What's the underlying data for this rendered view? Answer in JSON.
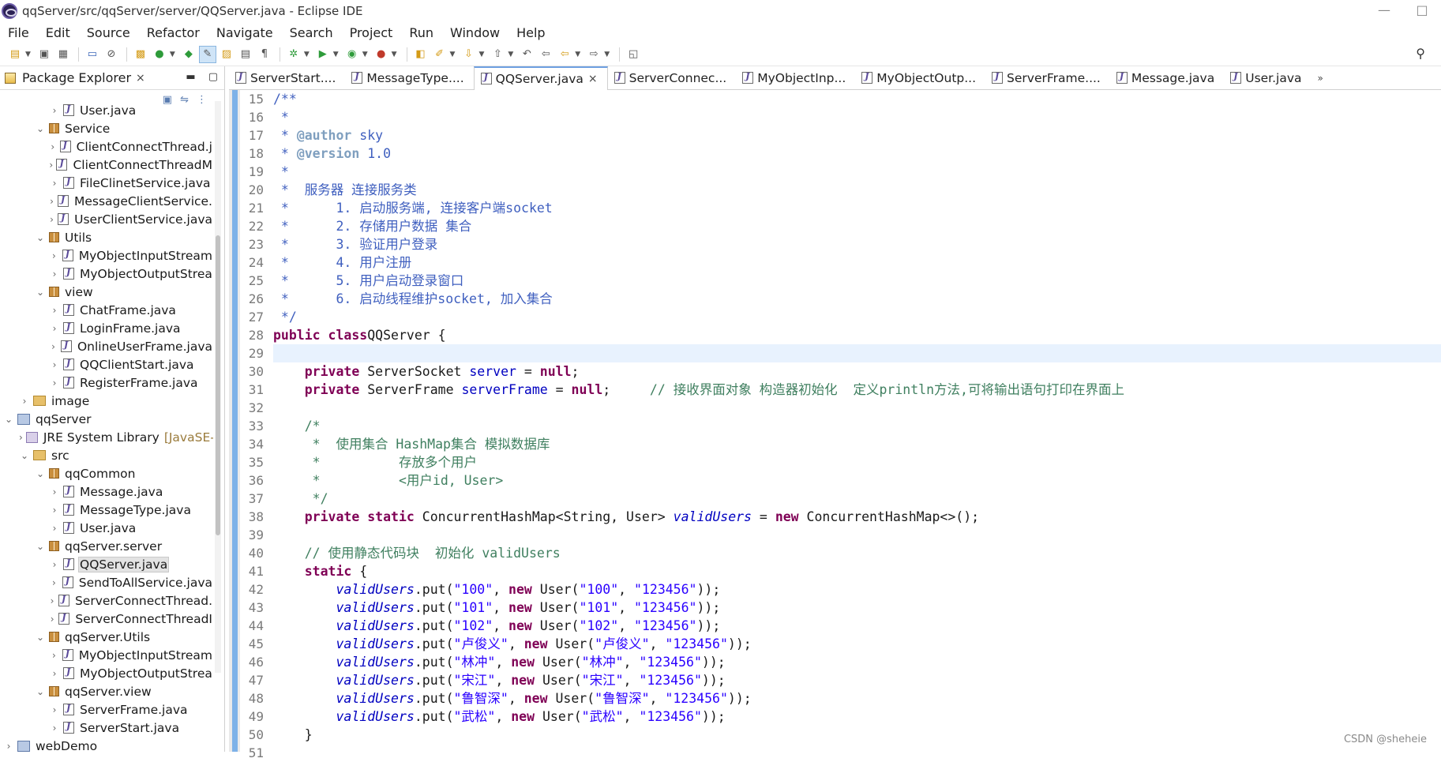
{
  "window": {
    "title": "qqServer/src/qqServer/server/QQServer.java - Eclipse IDE",
    "minimize": "—",
    "maximize": "□"
  },
  "menu": [
    "File",
    "Edit",
    "Source",
    "Refactor",
    "Navigate",
    "Search",
    "Project",
    "Run",
    "Window",
    "Help"
  ],
  "explorer": {
    "title": "Package Explorer",
    "close": "×",
    "minimize": "▬",
    "maximize": "▢",
    "tree": [
      {
        "label": "User.java",
        "type": "java",
        "depth": 3,
        "arrow": "›"
      },
      {
        "label": "Service",
        "type": "pkg",
        "depth": 2,
        "arrow": "⌄"
      },
      {
        "label": "ClientConnectThread.j",
        "type": "java",
        "depth": 3,
        "arrow": "›"
      },
      {
        "label": "ClientConnectThreadM",
        "type": "java",
        "depth": 3,
        "arrow": "›"
      },
      {
        "label": "FileClinetService.java",
        "type": "java",
        "depth": 3,
        "arrow": "›"
      },
      {
        "label": "MessageClientService.",
        "type": "java",
        "depth": 3,
        "arrow": "›"
      },
      {
        "label": "UserClientService.java",
        "type": "java",
        "depth": 3,
        "arrow": "›"
      },
      {
        "label": "Utils",
        "type": "pkg",
        "depth": 2,
        "arrow": "⌄"
      },
      {
        "label": "MyObjectInputStream",
        "type": "java",
        "depth": 3,
        "arrow": "›"
      },
      {
        "label": "MyObjectOutputStrea",
        "type": "java",
        "depth": 3,
        "arrow": "›"
      },
      {
        "label": "view",
        "type": "pkg",
        "depth": 2,
        "arrow": "⌄"
      },
      {
        "label": "ChatFrame.java",
        "type": "java",
        "depth": 3,
        "arrow": "›"
      },
      {
        "label": "LoginFrame.java",
        "type": "java",
        "depth": 3,
        "arrow": "›"
      },
      {
        "label": "OnlineUserFrame.java",
        "type": "java",
        "depth": 3,
        "arrow": "›"
      },
      {
        "label": "QQClientStart.java",
        "type": "java",
        "depth": 3,
        "arrow": "›"
      },
      {
        "label": "RegisterFrame.java",
        "type": "java",
        "depth": 3,
        "arrow": "›"
      },
      {
        "label": "image",
        "type": "folder",
        "depth": 1,
        "arrow": "›"
      },
      {
        "label": "qqServer",
        "type": "proj",
        "depth": 0,
        "arrow": "⌄"
      },
      {
        "label": "JRE System Library",
        "suffix": "[JavaSE-1",
        "type": "lib",
        "depth": 1,
        "arrow": "›"
      },
      {
        "label": "src",
        "type": "folder",
        "depth": 1,
        "arrow": "⌄"
      },
      {
        "label": "qqCommon",
        "type": "pkg",
        "depth": 2,
        "arrow": "⌄"
      },
      {
        "label": "Message.java",
        "type": "java",
        "depth": 3,
        "arrow": "›"
      },
      {
        "label": "MessageType.java",
        "type": "java",
        "depth": 3,
        "arrow": "›"
      },
      {
        "label": "User.java",
        "type": "java",
        "depth": 3,
        "arrow": "›"
      },
      {
        "label": "qqServer.server",
        "type": "pkg",
        "depth": 2,
        "arrow": "⌄"
      },
      {
        "label": "QQServer.java",
        "type": "java",
        "depth": 3,
        "arrow": "›",
        "selected": true
      },
      {
        "label": "SendToAllService.java",
        "type": "java",
        "depth": 3,
        "arrow": "›"
      },
      {
        "label": "ServerConnectThread.",
        "type": "java",
        "depth": 3,
        "arrow": "›"
      },
      {
        "label": "ServerConnectThreadI",
        "type": "java",
        "depth": 3,
        "arrow": "›"
      },
      {
        "label": "qqServer.Utils",
        "type": "pkg",
        "depth": 2,
        "arrow": "⌄"
      },
      {
        "label": "MyObjectInputStream",
        "type": "java",
        "depth": 3,
        "arrow": "›"
      },
      {
        "label": "MyObjectOutputStrea",
        "type": "java",
        "depth": 3,
        "arrow": "›"
      },
      {
        "label": "qqServer.view",
        "type": "pkg",
        "depth": 2,
        "arrow": "⌄"
      },
      {
        "label": "ServerFrame.java",
        "type": "java",
        "depth": 3,
        "arrow": "›"
      },
      {
        "label": "ServerStart.java",
        "type": "java",
        "depth": 3,
        "arrow": "›"
      },
      {
        "label": "webDemo",
        "type": "proj",
        "depth": 0,
        "arrow": "›"
      }
    ]
  },
  "editor_tabs": [
    {
      "label": "ServerStart....",
      "active": false
    },
    {
      "label": "MessageType....",
      "active": false
    },
    {
      "label": "QQServer.java",
      "active": true,
      "close": "×"
    },
    {
      "label": "ServerConnec...",
      "active": false
    },
    {
      "label": "MyObjectInp...",
      "active": false
    },
    {
      "label": "MyObjectOutp...",
      "active": false
    },
    {
      "label": "ServerFrame....",
      "active": false
    },
    {
      "label": "Message.java",
      "active": false
    },
    {
      "label": "User.java",
      "active": false
    }
  ],
  "tabs_overflow": "»",
  "line_numbers": [
    "15",
    "16",
    "17",
    "18",
    "19",
    "20",
    "21",
    "22",
    "23",
    "24",
    "25",
    "26",
    "27",
    "28",
    "29",
    "30",
    "31",
    "32",
    "33",
    "34",
    "35",
    "36",
    "37",
    "38",
    "39",
    "40",
    "41",
    "42",
    "43",
    "44",
    "45",
    "46",
    "47",
    "48",
    "49",
    "50",
    "51"
  ],
  "code_lines": [
    [
      [
        "c-comment",
        "/**"
      ]
    ],
    [
      [
        "c-comment",
        " *"
      ]
    ],
    [
      [
        "c-comment",
        " * "
      ],
      [
        "c-doctag",
        "@author"
      ],
      [
        "c-comment",
        " sky"
      ]
    ],
    [
      [
        "c-comment",
        " * "
      ],
      [
        "c-doctag",
        "@version"
      ],
      [
        "c-comment",
        " 1.0"
      ]
    ],
    [
      [
        "c-comment",
        " *"
      ]
    ],
    [
      [
        "c-comment",
        " *  服务器 连接服务类"
      ]
    ],
    [
      [
        "c-comment",
        " *      1. 启动服务端, 连接客户端socket"
      ]
    ],
    [
      [
        "c-comment",
        " *      2. 存储用户数据 集合"
      ]
    ],
    [
      [
        "c-comment",
        " *      3. 验证用户登录"
      ]
    ],
    [
      [
        "c-comment",
        " *      4. 用户注册"
      ]
    ],
    [
      [
        "c-comment",
        " *      5. 用户启动登录窗口"
      ]
    ],
    [
      [
        "c-comment",
        " *      6. 启动线程维护socket, 加入集合"
      ]
    ],
    [
      [
        "c-comment",
        " */"
      ]
    ],
    [
      [
        "c-kw",
        "public class"
      ],
      [
        "",
        "QQServer {"
      ]
    ],
    [
      [
        "",
        ""
      ]
    ],
    [
      [
        "",
        "    "
      ],
      [
        "c-kw",
        "private"
      ],
      [
        "",
        " ServerSocket "
      ],
      [
        "c-field",
        "server"
      ],
      [
        "",
        " = "
      ],
      [
        "c-kw",
        "null"
      ],
      [
        "",
        ";"
      ]
    ],
    [
      [
        "",
        "    "
      ],
      [
        "c-kw",
        "private"
      ],
      [
        "",
        " ServerFrame "
      ],
      [
        "c-field",
        "serverFrame"
      ],
      [
        "",
        " = "
      ],
      [
        "c-kw",
        "null"
      ],
      [
        "",
        ";     "
      ],
      [
        "c-comment2",
        "// 接收界面对象 构造器初始化  定义println方法,可将输出语句打印在界面上"
      ]
    ],
    [
      [
        "",
        ""
      ]
    ],
    [
      [
        "",
        "    "
      ],
      [
        "c-comment2",
        "/*"
      ]
    ],
    [
      [
        "",
        "    "
      ],
      [
        "c-comment2",
        " *  使用集合 HashMap集合 模拟数据库"
      ]
    ],
    [
      [
        "",
        "    "
      ],
      [
        "c-comment2",
        " *          存放多个用户"
      ]
    ],
    [
      [
        "",
        "    "
      ],
      [
        "c-comment2",
        " *          <用户id, User>"
      ]
    ],
    [
      [
        "",
        "    "
      ],
      [
        "c-comment2",
        " */"
      ]
    ],
    [
      [
        "",
        "    "
      ],
      [
        "c-kw",
        "private static"
      ],
      [
        "",
        " ConcurrentHashMap<String, User> "
      ],
      [
        "c-static",
        "validUsers"
      ],
      [
        "",
        " = "
      ],
      [
        "c-kw",
        "new"
      ],
      [
        "",
        " ConcurrentHashMap<>();"
      ]
    ],
    [
      [
        "",
        ""
      ]
    ],
    [
      [
        "",
        "    "
      ],
      [
        "c-comment2",
        "// 使用静态代码块  初始化 validUsers"
      ]
    ],
    [
      [
        "",
        "    "
      ],
      [
        "c-kw",
        "static"
      ],
      [
        "",
        " {"
      ]
    ],
    [
      [
        "",
        "        "
      ],
      [
        "c-static",
        "validUsers"
      ],
      [
        "",
        ".put("
      ],
      [
        "c-str",
        "\"100\""
      ],
      [
        "",
        ", "
      ],
      [
        "c-kw",
        "new"
      ],
      [
        "",
        " User("
      ],
      [
        "c-str",
        "\"100\""
      ],
      [
        "",
        ", "
      ],
      [
        "c-str",
        "\"123456\""
      ],
      [
        "",
        "));"
      ]
    ],
    [
      [
        "",
        "        "
      ],
      [
        "c-static",
        "validUsers"
      ],
      [
        "",
        ".put("
      ],
      [
        "c-str",
        "\"101\""
      ],
      [
        "",
        ", "
      ],
      [
        "c-kw",
        "new"
      ],
      [
        "",
        " User("
      ],
      [
        "c-str",
        "\"101\""
      ],
      [
        "",
        ", "
      ],
      [
        "c-str",
        "\"123456\""
      ],
      [
        "",
        "));"
      ]
    ],
    [
      [
        "",
        "        "
      ],
      [
        "c-static",
        "validUsers"
      ],
      [
        "",
        ".put("
      ],
      [
        "c-str",
        "\"102\""
      ],
      [
        "",
        ", "
      ],
      [
        "c-kw",
        "new"
      ],
      [
        "",
        " User("
      ],
      [
        "c-str",
        "\"102\""
      ],
      [
        "",
        ", "
      ],
      [
        "c-str",
        "\"123456\""
      ],
      [
        "",
        "));"
      ]
    ],
    [
      [
        "",
        "        "
      ],
      [
        "c-static",
        "validUsers"
      ],
      [
        "",
        ".put("
      ],
      [
        "c-str",
        "\"卢俊义\""
      ],
      [
        "",
        ", "
      ],
      [
        "c-kw",
        "new"
      ],
      [
        "",
        " User("
      ],
      [
        "c-str",
        "\"卢俊义\""
      ],
      [
        "",
        ", "
      ],
      [
        "c-str",
        "\"123456\""
      ],
      [
        "",
        "));"
      ]
    ],
    [
      [
        "",
        "        "
      ],
      [
        "c-static",
        "validUsers"
      ],
      [
        "",
        ".put("
      ],
      [
        "c-str",
        "\"林冲\""
      ],
      [
        "",
        ", "
      ],
      [
        "c-kw",
        "new"
      ],
      [
        "",
        " User("
      ],
      [
        "c-str",
        "\"林冲\""
      ],
      [
        "",
        ", "
      ],
      [
        "c-str",
        "\"123456\""
      ],
      [
        "",
        "));"
      ]
    ],
    [
      [
        "",
        "        "
      ],
      [
        "c-static",
        "validUsers"
      ],
      [
        "",
        ".put("
      ],
      [
        "c-str",
        "\"宋江\""
      ],
      [
        "",
        ", "
      ],
      [
        "c-kw",
        "new"
      ],
      [
        "",
        " User("
      ],
      [
        "c-str",
        "\"宋江\""
      ],
      [
        "",
        ", "
      ],
      [
        "c-str",
        "\"123456\""
      ],
      [
        "",
        "));"
      ]
    ],
    [
      [
        "",
        "        "
      ],
      [
        "c-static",
        "validUsers"
      ],
      [
        "",
        ".put("
      ],
      [
        "c-str",
        "\"鲁智深\""
      ],
      [
        "",
        ", "
      ],
      [
        "c-kw",
        "new"
      ],
      [
        "",
        " User("
      ],
      [
        "c-str",
        "\"鲁智深\""
      ],
      [
        "",
        ", "
      ],
      [
        "c-str",
        "\"123456\""
      ],
      [
        "",
        "));"
      ]
    ],
    [
      [
        "",
        "        "
      ],
      [
        "c-static",
        "validUsers"
      ],
      [
        "",
        ".put("
      ],
      [
        "c-str",
        "\"武松\""
      ],
      [
        "",
        ", "
      ],
      [
        "c-kw",
        "new"
      ],
      [
        "",
        " User("
      ],
      [
        "c-str",
        "\"武松\""
      ],
      [
        "",
        ", "
      ],
      [
        "c-str",
        "\"123456\""
      ],
      [
        "",
        "));"
      ]
    ],
    [
      [
        "",
        "    }"
      ]
    ],
    [
      [
        "",
        ""
      ]
    ]
  ],
  "current_line_index": 14,
  "watermark": "CSDN @sheheie"
}
